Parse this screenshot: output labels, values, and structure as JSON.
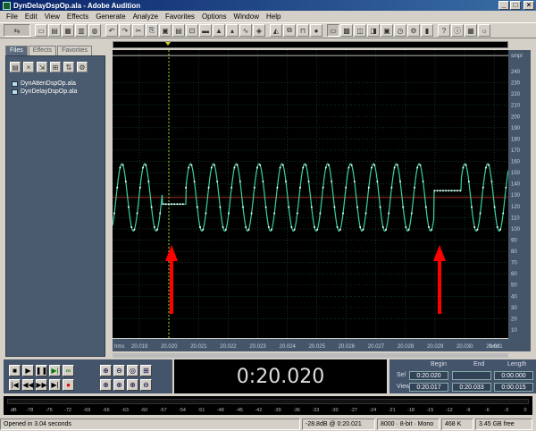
{
  "window": {
    "title": "DynDelayDspOp.ala - Adobe Audition"
  },
  "menu": [
    "File",
    "Edit",
    "View",
    "Effects",
    "Generate",
    "Analyze",
    "Favorites",
    "Options",
    "Window",
    "Help"
  ],
  "left_panel": {
    "tabs": [
      "Files",
      "Effects",
      "Favorites"
    ],
    "files": [
      "DynAttenDspOp.ala",
      "DynDelayDspOp.ala"
    ]
  },
  "waveform": {
    "x_axis_labels": [
      "hms",
      "20.019",
      "20.020",
      "20.021",
      "20.022",
      "20.023",
      "20.024",
      "20.025",
      "20.026",
      "20.027",
      "20.028",
      "20.029",
      "20.030",
      "20.031",
      "20.032",
      "hms"
    ],
    "y_axis_labels": [
      "smpl",
      "240",
      "230",
      "220",
      "210",
      "200",
      "190",
      "180",
      "170",
      "160",
      "150",
      "140",
      "130",
      "120",
      "110",
      "100",
      "90",
      "80",
      "70",
      "60",
      "50",
      "40",
      "30",
      "20",
      "10"
    ],
    "colors": {
      "background": "#000000",
      "waveform": "#3bd1a3",
      "grid": "#1b5b2a",
      "center_line": "#a12a2a",
      "arrow": "#ff0000",
      "cursor": "#9cd71f"
    }
  },
  "time_display": "0:20.020",
  "selection_view": {
    "headers": [
      "Begin",
      "End",
      "Length"
    ],
    "sel_label": "Sel",
    "view_label": "View",
    "sel_begin": "0:20.020",
    "sel_end": "",
    "sel_length": "0:00.000",
    "view_begin": "0:20.017",
    "view_end": "0:20.033",
    "view_length": "0:00.015"
  },
  "level_meter_labels": [
    "dB",
    "-78",
    "-75",
    "-72",
    "-69",
    "-66",
    "-63",
    "-60",
    "-57",
    "-54",
    "-51",
    "-48",
    "-45",
    "-42",
    "-39",
    "-36",
    "-33",
    "-30",
    "-27",
    "-24",
    "-21",
    "-18",
    "-15",
    "-12",
    "-9",
    "-6",
    "-3",
    "0"
  ],
  "status_bar": {
    "message": "Opened in 3.04 seconds",
    "cursor_info": "-28.8dB @  0:20.021",
    "format": "8000 · 8-bit · Mono",
    "size": "468 K",
    "free": "3.45 GB free"
  }
}
